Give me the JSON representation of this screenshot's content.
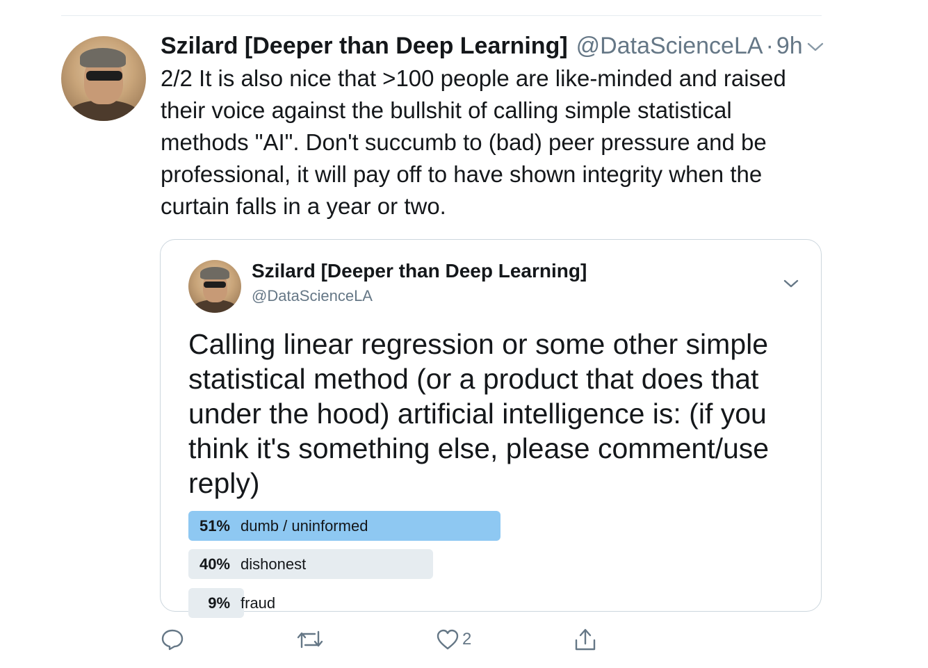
{
  "tweet": {
    "display_name": "Szilard [Deeper than Deep Learning]",
    "handle": "@DataScienceLA",
    "separator": "·",
    "time": "9h",
    "text": "2/2 It is also nice that >100 people are like-minded and raised their voice against the bullshit of calling simple statistical methods \"AI\". Don't succumb to (bad) peer pressure and be professional, it will pay off to have shown integrity when the curtain falls in a year or two."
  },
  "quoted_tweet": {
    "display_name": "Szilard [Deeper than Deep Learning]",
    "handle": "@DataScienceLA",
    "text": "Calling linear regression or some other simple statistical method (or a product that does that under the hood) artificial intelligence is: (if you think it's something else, please comment/use reply)",
    "poll": [
      {
        "percent_label": "51%",
        "fraction": 0.51,
        "label": "dumb / uninformed",
        "winner": true
      },
      {
        "percent_label": "40%",
        "fraction": 0.4,
        "label": "dishonest",
        "winner": false
      },
      {
        "percent_label": "9%",
        "fraction": 0.09,
        "label": "fraud",
        "winner": false
      }
    ]
  },
  "actions": {
    "reply_icon": "reply-icon",
    "retweet_icon": "retweet-icon",
    "like_icon": "heart-icon",
    "like_count": "2",
    "share_icon": "share-icon"
  },
  "colors": {
    "text": "#14171a",
    "secondary": "#657786",
    "border": "#ccd6dd",
    "poll_winner": "#8ec8f2",
    "poll_other": "#e6ecf0"
  }
}
